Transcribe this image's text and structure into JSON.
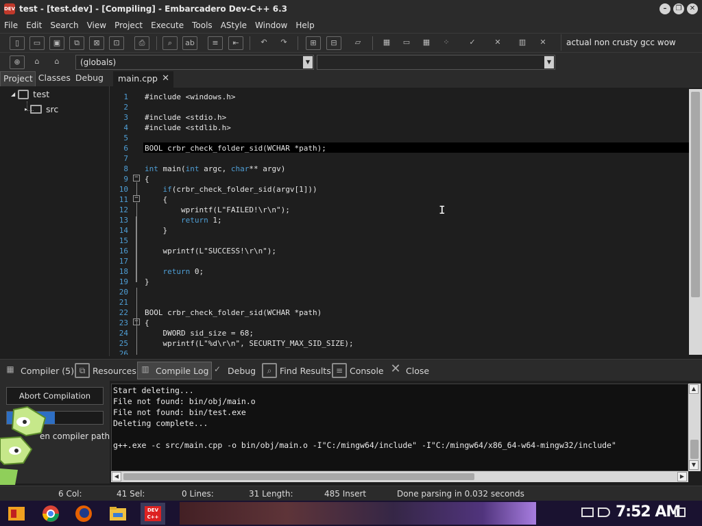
{
  "window": {
    "title": "test - [test.dev] - [Compiling] - Embarcadero Dev-C++ 6.3",
    "icon_label": "DEV"
  },
  "menu": [
    "File",
    "Edit",
    "Search",
    "View",
    "Project",
    "Execute",
    "Tools",
    "AStyle",
    "Window",
    "Help"
  ],
  "compiler_set": "actual non crusty gcc wow",
  "scope": "(globals)",
  "left_tabs": [
    "Project",
    "Classes",
    "Debug"
  ],
  "tree": {
    "project": "test",
    "folder": "src"
  },
  "editor": {
    "tab": "main.cpp",
    "lines": [
      "#include <windows.h>",
      "",
      "#include <stdio.h>",
      "#include <stdlib.h>",
      "",
      "BOOL crbr_check_folder_sid(WCHAR *path);",
      "",
      "int main(int argc, char** argv)",
      "{",
      "    if(crbr_check_folder_sid(argv[1]))",
      "    {",
      "        wprintf(L\"FAILED!\\r\\n\");",
      "        return 1;",
      "    }",
      "",
      "    wprintf(L\"SUCCESS!\\r\\n\");",
      "",
      "    return 0;",
      "}",
      "",
      "",
      "BOOL crbr_check_folder_sid(WCHAR *path)",
      "{",
      "    DWORD sid_size = 68;",
      "    wprintf(L\"%d\\r\\n\", SECURITY_MAX_SID_SIZE);",
      ""
    ],
    "line_numbers": [
      "1",
      "2",
      "3",
      "4",
      "5",
      "6",
      "7",
      "8",
      "9",
      "10",
      "11",
      "12",
      "13",
      "14",
      "15",
      "16",
      "17",
      "18",
      "19",
      "20",
      "21",
      "22",
      "23",
      "24",
      "25",
      "26"
    ]
  },
  "bottom_tabs": [
    "Compiler (5)",
    "Resources",
    "Compile Log",
    "Debug",
    "Find Results",
    "Console",
    "Close"
  ],
  "compile": {
    "abort_label": "Abort Compilation",
    "progress": 0.5,
    "path_label": "en compiler path",
    "log": [
      "Start deleting...",
      "File not found: bin/obj/main.o",
      "File not found: bin/test.exe",
      "Deleting complete...",
      "",
      "g++.exe -c src/main.cpp -o bin/obj/main.o -I\"C:/mingw64/include\" -I\"C:/mingw64/x86_64-w64-mingw32/include\""
    ]
  },
  "status": {
    "line": "6 Col:",
    "col": "41 Sel:",
    "sel": "0 Lines:",
    "lines": "31 Length:",
    "length": "485 Insert",
    "message": "Done parsing in 0.032 seconds"
  },
  "taskbar": {
    "clock": "7:52 AM",
    "devcpp_icon_label": "DEV C++"
  },
  "colors": {
    "background": "#1e1e1e",
    "panel": "#2b2b2b",
    "line_number": "#4f9fd6",
    "keyword": "#4f9fd6",
    "progress": "#2e6fc4"
  }
}
